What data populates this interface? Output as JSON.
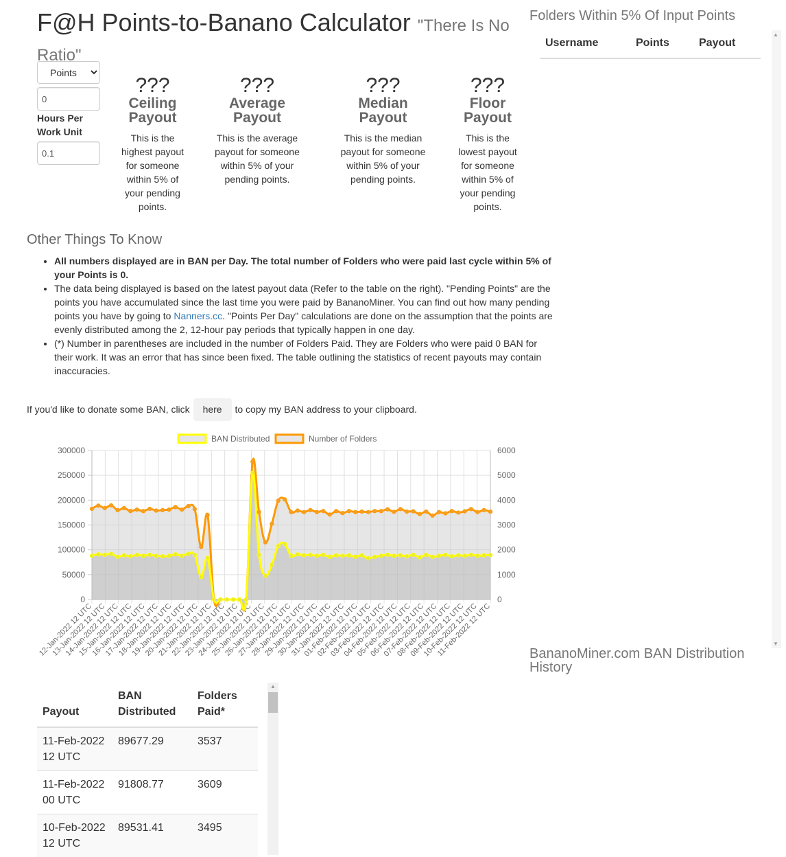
{
  "header": {
    "title": "F@H Points-to-Banano Calculator",
    "subtitle": "\"There Is No Ratio\""
  },
  "form": {
    "unit_select": {
      "selected": "Points"
    },
    "points_value": "0",
    "hours_label": "Hours Per Work Unit",
    "hours_value": "0.1"
  },
  "stats": [
    {
      "value": "???",
      "name": "Ceiling Payout",
      "desc": "This is the highest payout for someone within 5% of your pending points."
    },
    {
      "value": "???",
      "name": "Average Payout",
      "desc": "This is the average payout for someone within 5% of your pending points."
    },
    {
      "value": "???",
      "name": "Median Payout",
      "desc": "This is the median payout for someone within 5% of your pending points."
    },
    {
      "value": "???",
      "name": "Floor Payout",
      "desc": "This is the lowest payout for someone within 5% of your pending points."
    }
  ],
  "other": {
    "title": "Other Things To Know",
    "note1": "All numbers displayed are in BAN per Day. The total number of Folders who were paid last cycle within 5% of your Points is 0.",
    "note2_a": "The data being displayed is based on the latest payout data (Refer to the table on the right). \"Pending Points\" are the points you have accumulated since the last time you were paid by BananoMiner. You can find out how many pending points you have by going to ",
    "note2_link": "Nanners.cc",
    "note2_b": ". \"Points Per Day\" calculations are done on the assumption that the points are evenly distributed among the 2, 12-hour pay periods that typically happen in one day.",
    "note3": "(*) Number in parentheses are included in the number of Folders Paid. They are Folders who were paid 0 BAN for their work. It was an error that has since been fixed. The table outlining the statistics of recent payouts may contain inaccuracies."
  },
  "donate": {
    "before": "If you'd like to donate some BAN, click",
    "button": "here",
    "after": "to copy my BAN address to your clipboard."
  },
  "right_panel": {
    "title": "Folders Within 5% Of Input Points",
    "columns": [
      "Username",
      "Points",
      "Payout"
    ]
  },
  "history_title": "BananoMiner.com BAN Distribution History",
  "dist_table": {
    "columns": [
      "Payout",
      "BAN Distributed",
      "Folders Paid*"
    ],
    "rows": [
      [
        "11-Feb-2022 12 UTC",
        "89677.29",
        "3537"
      ],
      [
        "11-Feb-2022 00 UTC",
        "91808.77",
        "3609"
      ],
      [
        "10-Feb-2022 12 UTC",
        "89531.41",
        "3495"
      ]
    ]
  },
  "colors": {
    "ban_line": "#ffff00",
    "folders_line": "#ff9900",
    "link": "#337ab7"
  },
  "chart_data": {
    "type": "line",
    "legend": [
      "BAN Distributed",
      "Number of Folders"
    ],
    "legend_position": "top",
    "y_left": {
      "min": 0,
      "max": 300000,
      "ticks": [
        "300000",
        "250000",
        "200000",
        "150000",
        "100000",
        "50000",
        "0"
      ]
    },
    "y_right": {
      "min": 0,
      "max": 6000,
      "ticks": [
        "6000",
        "5000",
        "4000",
        "3000",
        "2000",
        "1000",
        "0"
      ]
    },
    "x_labels": [
      "12-Jan-2022 12 UTC",
      "13-Jan-2022 12 UTC",
      "14-Jan-2022 12 UTC",
      "15-Jan-2022 12 UTC",
      "16-Jan-2022 12 UTC",
      "17-Jan-2022 12 UTC",
      "18-Jan-2022 12 UTC",
      "19-Jan-2022 12 UTC",
      "20-Jan-2022 12 UTC",
      "21-Jan-2022 12 UTC",
      "22-Jan-2022 12 UTC",
      "23-Jan-2022 12 UTC",
      "24-Jan-2022 12 UTC",
      "25-Jan-2022 12 UTC",
      "26-Jan-2022 12 UTC",
      "27-Jan-2022 12 UTC",
      "28-Jan-2022 12 UTC",
      "29-Jan-2022 12 UTC",
      "30-Jan-2022 12 UTC",
      "31-Jan-2022 12 UTC",
      "01-Feb-2022 12 UTC",
      "02-Feb-2022 12 UTC",
      "03-Feb-2022 12 UTC",
      "04-Feb-2022 12 UTC",
      "05-Feb-2022 12 UTC",
      "06-Feb-2022 12 UTC",
      "07-Feb-2022 12 UTC",
      "08-Feb-2022 12 UTC",
      "09-Feb-2022 12 UTC",
      "10-Feb-2022 12 UTC",
      "11-Feb-2022 12 UTC"
    ],
    "grid": true,
    "series": [
      {
        "name": "BAN Distributed",
        "axis": "left",
        "values": [
          88000,
          91000,
          90000,
          92000,
          86000,
          89000,
          87000,
          90000,
          88000,
          90000,
          88000,
          87000,
          88000,
          91000,
          88000,
          92000,
          90000,
          45000,
          84000,
          0,
          0,
          0,
          0,
          0,
          0,
          255000,
          90000,
          48000,
          70000,
          108000,
          112000,
          88000,
          91000,
          89000,
          90000,
          88000,
          90000,
          86000,
          89000,
          88000,
          89000,
          86000,
          89000,
          83000,
          86000,
          88000,
          90000,
          88000,
          89000,
          87000,
          90000,
          85000,
          90000,
          86000,
          88000,
          90000,
          87000,
          89000,
          88000,
          90000,
          88000,
          89000,
          89677
        ]
      },
      {
        "name": "Number of Folders",
        "axis": "right",
        "values": [
          3650,
          3780,
          3680,
          3790,
          3600,
          3680,
          3560,
          3620,
          3560,
          3650,
          3580,
          3600,
          3620,
          3720,
          3620,
          3760,
          3640,
          2120,
          3400,
          0,
          0,
          0,
          0,
          0,
          0,
          5550,
          3520,
          2300,
          3050,
          3980,
          4030,
          3520,
          3580,
          3520,
          3600,
          3520,
          3560,
          3420,
          3560,
          3480,
          3560,
          3520,
          3540,
          3520,
          3560,
          3560,
          3630,
          3530,
          3640,
          3540,
          3550,
          3440,
          3540,
          3380,
          3520,
          3470,
          3560,
          3500,
          3550,
          3640,
          3520,
          3600,
          3537
        ]
      }
    ]
  }
}
